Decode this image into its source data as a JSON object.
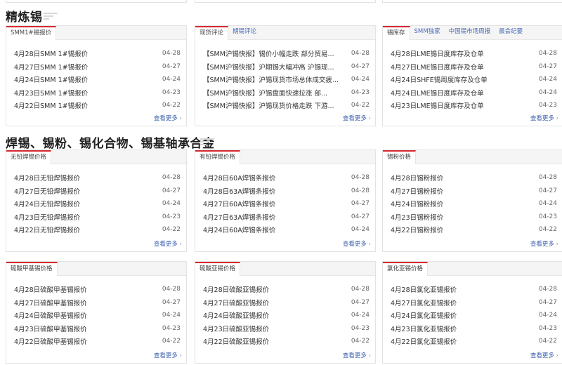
{
  "sections": [
    {
      "title": "精炼锡"
    },
    {
      "title": "焊锡、锡粉、锡化合物、锡基轴承合金"
    }
  ],
  "cards": [
    {
      "tabs": [
        "SMM1#锡报价"
      ],
      "items": [
        {
          "t": "4月28日SMM 1#锡报价",
          "d": "04-28"
        },
        {
          "t": "4月27日SMM 1#锡报价",
          "d": "04-27"
        },
        {
          "t": "4月24日SMM 1#锡报价",
          "d": "04-24"
        },
        {
          "t": "4月23日SMM 1#锡报价",
          "d": "04-23"
        },
        {
          "t": "4月22日SMM 1#锡报价",
          "d": "04-22"
        }
      ],
      "more": "查看更多"
    },
    {
      "tabs": [
        "现货评论",
        "期锡评论"
      ],
      "items": [
        {
          "t": "【SMM沪锡快报】锡价小幅走跌 部分贸易...",
          "d": "04-28"
        },
        {
          "t": "【SMM沪锡快报】沪期锡大幅冲高 沪锡现...",
          "d": "04-27"
        },
        {
          "t": "【SMM沪锡快报】沪锡现货市场总体成交疲...",
          "d": "04-24"
        },
        {
          "t": "【SMM沪锡快报】沪锡盘面快速拉涨 部...",
          "d": "04-23"
        },
        {
          "t": "【SMM沪锡快报】沪锡现货价格走跌 下游...",
          "d": "04-22"
        }
      ],
      "more": "查看更多"
    },
    {
      "tabs": [
        "锡库存",
        "SMM独家",
        "中国锡市场周报",
        "晨会纪要"
      ],
      "items": [
        {
          "t": "4月28日LME锡日度库存及仓单",
          "d": "04-28"
        },
        {
          "t": "4月27日LME锡日度库存及仓单",
          "d": "04-27"
        },
        {
          "t": "4月24日SHFE锡周度库存及仓单",
          "d": "04-24"
        },
        {
          "t": "4月24日LME锡日度库存及仓单",
          "d": "04-24"
        },
        {
          "t": "4月23日LME锡日度库存及仓单",
          "d": "04-23"
        }
      ],
      "more": "查看更多"
    },
    {
      "tabs": [
        "无铅焊锡价格"
      ],
      "items": [
        {
          "t": "4月28日无铅焊锡报价",
          "d": "04-28"
        },
        {
          "t": "4月27日无铅焊锡报价",
          "d": "04-27"
        },
        {
          "t": "4月24日无铅焊锡报价",
          "d": "04-24"
        },
        {
          "t": "4月23日无铅焊锡报价",
          "d": "04-23"
        },
        {
          "t": "4月22日无铅焊锡报价",
          "d": "04-22"
        }
      ],
      "more": "查看更多"
    },
    {
      "tabs": [
        "有铅焊锡价格"
      ],
      "items": [
        {
          "t": "4月28日60A焊锡条报价",
          "d": "04-28"
        },
        {
          "t": "4月28日63A焊锡条报价",
          "d": "04-28"
        },
        {
          "t": "4月27日60A焊锡条报价",
          "d": "04-27"
        },
        {
          "t": "4月27日63A焊锡条报价",
          "d": "04-27"
        },
        {
          "t": "4月24日60A焊锡条报价",
          "d": "04-24"
        }
      ],
      "more": "查看更多"
    },
    {
      "tabs": [
        "锡粉价格"
      ],
      "items": [
        {
          "t": "4月28日锡粉报价",
          "d": "04-28"
        },
        {
          "t": "4月27日锡粉报价",
          "d": "04-27"
        },
        {
          "t": "4月24日锡粉报价",
          "d": "04-24"
        },
        {
          "t": "4月23日锡粉报价",
          "d": "04-23"
        },
        {
          "t": "4月22日锡粉报价",
          "d": "04-22"
        }
      ],
      "more": "查看更多"
    },
    {
      "tabs": [
        "硫酸甲基锡价格"
      ],
      "items": [
        {
          "t": "4月28日硫酸甲基锡报价",
          "d": "04-28"
        },
        {
          "t": "4月27日硫酸甲基锡报价",
          "d": "04-27"
        },
        {
          "t": "4月24日硫酸甲基锡报价",
          "d": "04-24"
        },
        {
          "t": "4月23日硫酸甲基锡报价",
          "d": "04-23"
        },
        {
          "t": "4月22日硫酸甲基锡报价",
          "d": "04-22"
        }
      ],
      "more": "查看更多"
    },
    {
      "tabs": [
        "硫酸亚锡价格"
      ],
      "items": [
        {
          "t": "4月28日硫酸亚锡报价",
          "d": "04-28"
        },
        {
          "t": "4月27日硫酸亚锡报价",
          "d": "04-27"
        },
        {
          "t": "4月24日硫酸亚锡报价",
          "d": "04-24"
        },
        {
          "t": "4月23日硫酸亚锡报价",
          "d": "04-23"
        },
        {
          "t": "4月22日硫酸亚锡报价",
          "d": "04-22"
        }
      ],
      "more": "查看更多"
    },
    {
      "tabs": [
        "氯化亚锡价格"
      ],
      "items": [
        {
          "t": "4月28日氯化亚锡报价",
          "d": "04-28"
        },
        {
          "t": "4月27日氯化亚锡报价",
          "d": "04-27"
        },
        {
          "t": "4月24日氯化亚锡报价",
          "d": "04-24"
        },
        {
          "t": "4月23日氯化亚锡报价",
          "d": "04-23"
        },
        {
          "t": "4月22日氯化亚锡报价",
          "d": "04-22"
        }
      ],
      "more": "查看更多"
    }
  ]
}
